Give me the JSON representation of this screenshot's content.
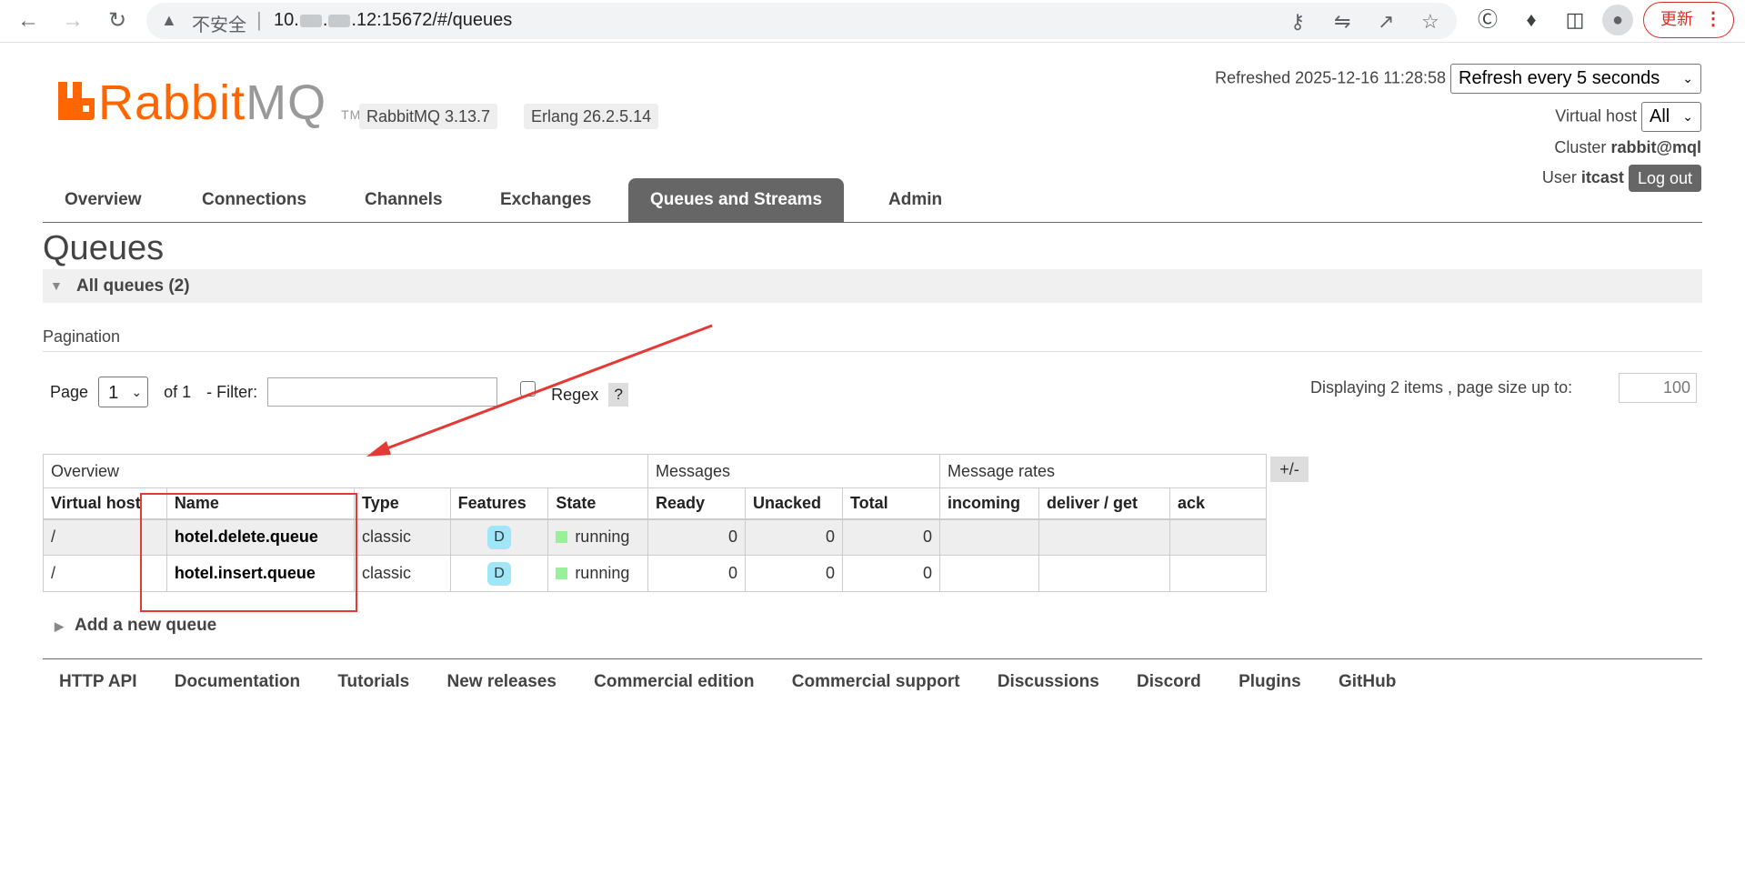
{
  "browser": {
    "insecure_label": "不安全",
    "url_prefix": "10.",
    "url_suffix": "12:15672/#/queues",
    "update_label": "更新"
  },
  "header": {
    "logo_rabbit": "Rabbit",
    "logo_mq": "MQ",
    "logo_tm": "TM",
    "rabbitmq_version": "RabbitMQ 3.13.7",
    "erlang_version": "Erlang 26.2.5.14",
    "refreshed_label": "Refreshed 2025-12-16 11:28:58",
    "refresh_select": "Refresh every 5 seconds",
    "virtual_host_label": "Virtual host",
    "virtual_host_value": "All",
    "cluster_label": "Cluster",
    "cluster_value": "rabbit@mql",
    "user_label": "User",
    "user_value": "itcast",
    "logout_label": "Log out"
  },
  "tabs": [
    {
      "label": "Overview"
    },
    {
      "label": "Connections"
    },
    {
      "label": "Channels"
    },
    {
      "label": "Exchanges"
    },
    {
      "label": "Queues and Streams",
      "active": true
    },
    {
      "label": "Admin"
    }
  ],
  "page": {
    "title": "Queues",
    "section": "All queues (2)",
    "pagination_label": "Pagination"
  },
  "pager": {
    "page_label": "Page",
    "page_value": "1",
    "of_label": "of 1",
    "filter_label": "- Filter:",
    "regex_label": "Regex",
    "help_label": "?",
    "display_info": "Displaying 2 items , page size up to:",
    "page_size": "100"
  },
  "table": {
    "groups": [
      "Overview",
      "Messages",
      "Message rates"
    ],
    "columns": [
      "Virtual host",
      "Name",
      "Type",
      "Features",
      "State",
      "Ready",
      "Unacked",
      "Total",
      "incoming",
      "deliver / get",
      "ack"
    ],
    "toggle_label": "+/-",
    "rows": [
      {
        "vhost": "/",
        "name": "hotel.delete.queue",
        "type": "classic",
        "feature": "D",
        "state": "running",
        "ready": "0",
        "unacked": "0",
        "total": "0"
      },
      {
        "vhost": "/",
        "name": "hotel.insert.queue",
        "type": "classic",
        "feature": "D",
        "state": "running",
        "ready": "0",
        "unacked": "0",
        "total": "0"
      }
    ]
  },
  "add_queue_label": "Add a new queue",
  "footer": [
    "HTTP API",
    "Documentation",
    "Tutorials",
    "New releases",
    "Commercial edition",
    "Commercial support",
    "Discussions",
    "Discord",
    "Plugins",
    "GitHub"
  ],
  "colors": {
    "brand_orange": "#ff6600",
    "tab_active": "#666666",
    "state_running": "#98f198",
    "feature_durable": "#9fe6f9",
    "annotation_red": "#e53935"
  }
}
